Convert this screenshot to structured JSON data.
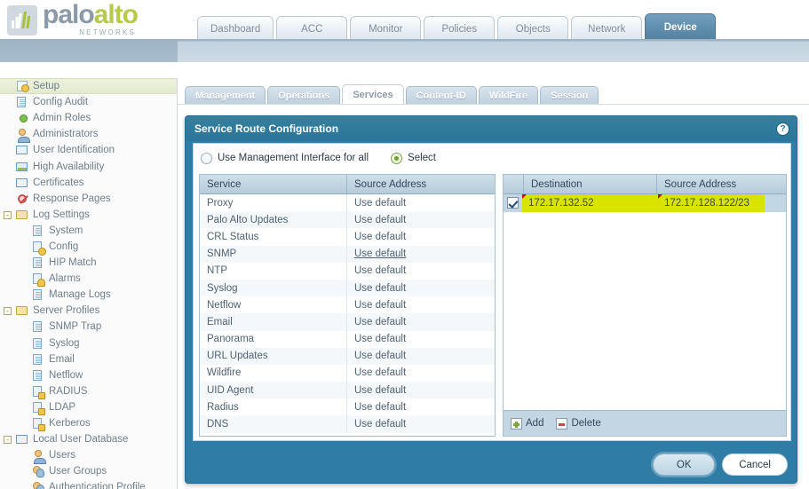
{
  "brand": {
    "name_part1": "palo",
    "name_part2": "alto",
    "tagline": "NETWORKS",
    "logo_icon": "bars-logo-icon"
  },
  "colors": {
    "accent_blue": "#2f7da6",
    "tab_active_blue": "#5e8dae",
    "highlight_yellow": "#d9e300",
    "brand_green": "#b9c94a",
    "brand_grey": "#8a9aa8"
  },
  "top_tabs": [
    {
      "label": "Dashboard",
      "active": false
    },
    {
      "label": "ACC",
      "active": false
    },
    {
      "label": "Monitor",
      "active": false
    },
    {
      "label": "Policies",
      "active": false
    },
    {
      "label": "Objects",
      "active": false
    },
    {
      "label": "Network",
      "active": false
    },
    {
      "label": "Device",
      "active": true
    }
  ],
  "sidebar": {
    "items": [
      {
        "label": "Setup",
        "icon": "key-icon",
        "level": 1,
        "selected": true,
        "expander": ""
      },
      {
        "label": "Config Audit",
        "icon": "document-icon",
        "level": 1,
        "selected": false,
        "expander": ""
      },
      {
        "label": "Admin Roles",
        "icon": "admin-roles-icon",
        "level": 1,
        "selected": false,
        "expander": ""
      },
      {
        "label": "Administrators",
        "icon": "person-icon",
        "level": 1,
        "selected": false,
        "expander": ""
      },
      {
        "label": "User Identification",
        "icon": "id-card-icon",
        "level": 1,
        "selected": false,
        "expander": ""
      },
      {
        "label": "High Availability",
        "icon": "high-availability-icon",
        "level": 1,
        "selected": false,
        "expander": ""
      },
      {
        "label": "Certificates",
        "icon": "certificate-icon",
        "level": 1,
        "selected": false,
        "expander": ""
      },
      {
        "label": "Response Pages",
        "icon": "deny-icon",
        "level": 1,
        "selected": false,
        "expander": ""
      },
      {
        "label": "Log Settings",
        "icon": "folder-icon",
        "level": 1,
        "selected": false,
        "expander": "-"
      },
      {
        "label": "System",
        "icon": "document-icon",
        "level": 2,
        "selected": false,
        "expander": ""
      },
      {
        "label": "Config",
        "icon": "gear-document-icon",
        "level": 2,
        "selected": false,
        "expander": ""
      },
      {
        "label": "HIP Match",
        "icon": "document-icon",
        "level": 2,
        "selected": false,
        "expander": ""
      },
      {
        "label": "Alarms",
        "icon": "bell-icon",
        "level": 2,
        "selected": false,
        "expander": ""
      },
      {
        "label": "Manage Logs",
        "icon": "document-icon",
        "level": 2,
        "selected": false,
        "expander": ""
      },
      {
        "label": "Server Profiles",
        "icon": "folder-icon",
        "level": 1,
        "selected": false,
        "expander": "-"
      },
      {
        "label": "SNMP Trap",
        "icon": "document-icon",
        "level": 2,
        "selected": false,
        "expander": ""
      },
      {
        "label": "Syslog",
        "icon": "document-icon",
        "level": 2,
        "selected": false,
        "expander": ""
      },
      {
        "label": "Email",
        "icon": "document-icon",
        "level": 2,
        "selected": false,
        "expander": ""
      },
      {
        "label": "Netflow",
        "icon": "document-icon",
        "level": 2,
        "selected": false,
        "expander": ""
      },
      {
        "label": "RADIUS",
        "icon": "lock-document-icon",
        "level": 2,
        "selected": false,
        "expander": ""
      },
      {
        "label": "LDAP",
        "icon": "lock-document-icon",
        "level": 2,
        "selected": false,
        "expander": ""
      },
      {
        "label": "Kerberos",
        "icon": "lock-document-icon",
        "level": 2,
        "selected": false,
        "expander": ""
      },
      {
        "label": "Local User Database",
        "icon": "id-card-icon",
        "level": 1,
        "selected": false,
        "expander": "-"
      },
      {
        "label": "Users",
        "icon": "person-icon",
        "level": 2,
        "selected": false,
        "expander": ""
      },
      {
        "label": "User Groups",
        "icon": "users-icon",
        "level": 2,
        "selected": false,
        "expander": ""
      },
      {
        "label": "Authentication Profile",
        "icon": "users-icon",
        "level": 2,
        "selected": false,
        "expander": ""
      }
    ]
  },
  "sub_tabs": [
    {
      "label": "Management",
      "active": false
    },
    {
      "label": "Operations",
      "active": false
    },
    {
      "label": "Services",
      "active": true
    },
    {
      "label": "Content-ID",
      "active": false
    },
    {
      "label": "WildFire",
      "active": false
    },
    {
      "label": "Session",
      "active": false
    }
  ],
  "dialog": {
    "title": "Service Route Configuration",
    "help_icon": "help-icon",
    "radio_options": [
      {
        "label": "Use Management Interface for all",
        "selected": false
      },
      {
        "label": "Select",
        "selected": true
      }
    ],
    "service_table": {
      "columns": [
        "Service",
        "Source Address"
      ],
      "rows": [
        {
          "service": "Proxy",
          "source_address": "Use default",
          "underlined": false
        },
        {
          "service": "Palo Alto Updates",
          "source_address": "Use default",
          "underlined": false
        },
        {
          "service": "CRL Status",
          "source_address": "Use default",
          "underlined": false
        },
        {
          "service": "SNMP",
          "source_address": "Use default",
          "underlined": true
        },
        {
          "service": "NTP",
          "source_address": "Use default",
          "underlined": false
        },
        {
          "service": "Syslog",
          "source_address": "Use default",
          "underlined": false
        },
        {
          "service": "Netflow",
          "source_address": "Use default",
          "underlined": false
        },
        {
          "service": "Email",
          "source_address": "Use default",
          "underlined": false
        },
        {
          "service": "Panorama",
          "source_address": "Use default",
          "underlined": false
        },
        {
          "service": "URL Updates",
          "source_address": "Use default",
          "underlined": false
        },
        {
          "service": "Wildfire",
          "source_address": "Use default",
          "underlined": false
        },
        {
          "service": "UID Agent",
          "source_address": "Use default",
          "underlined": false
        },
        {
          "service": "Radius",
          "source_address": "Use default",
          "underlined": false
        },
        {
          "service": "DNS",
          "source_address": "Use default",
          "underlined": false
        }
      ]
    },
    "destination_table": {
      "columns": [
        "Destination",
        "Source Address"
      ],
      "rows": [
        {
          "checked": true,
          "destination": "172.17.132.52",
          "source_address": "172.17.128.122/23",
          "highlighted": true
        }
      ],
      "add_label": "Add",
      "delete_label": "Delete",
      "add_icon": "plus-icon",
      "delete_icon": "minus-icon"
    },
    "ok_label": "OK",
    "cancel_label": "Cancel"
  }
}
